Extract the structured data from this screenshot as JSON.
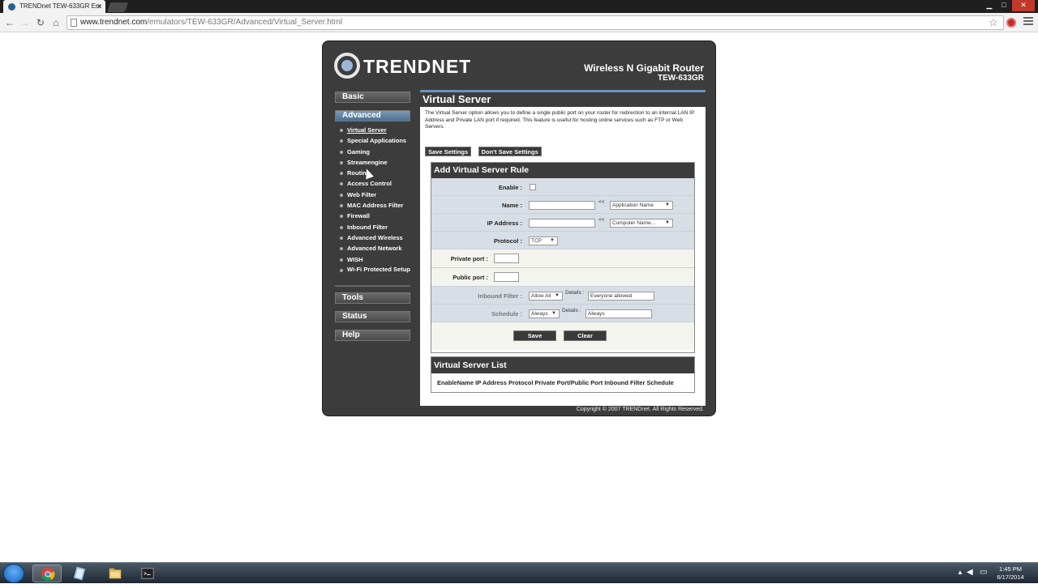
{
  "browser": {
    "tab_title": "TRENDnet TEW-633GR Em",
    "url_host": "www.trendnet.com",
    "url_path": "/emulators/TEW-633GR/Advanced/Virtual_Server.html"
  },
  "router": {
    "brand": "TRENDNET",
    "product_name": "Wireless N Gigabit Router",
    "product_model": "TEW-633GR",
    "copyright": "Copyright © 2007 TRENDnet. All Rights Reserved."
  },
  "nav": {
    "basic": "Basic",
    "advanced": "Advanced",
    "tools": "Tools",
    "status": "Status",
    "help": "Help",
    "sub_items": [
      "Virtual Server",
      "Special Applications",
      "Gaming",
      "Streamengine",
      "Routing",
      "Access Control",
      "Web Filter",
      "MAC Address Filter",
      "Firewall",
      "Inbound Filter",
      "Advanced Wireless",
      "Advanced Network",
      "WISH",
      "Wi-Fi Protected Setup"
    ]
  },
  "page": {
    "title": "Virtual Server",
    "description": "The Virtual Server option allows you to define a single public port on your router for redirection to an internal LAN IP Address and Private LAN port if required. This feature is useful for hosting online services such as FTP or Web Servers.",
    "save_settings": "Save Settings",
    "dont_save": "Don't Save Settings"
  },
  "rule_form": {
    "heading": "Add Virtual Server Rule",
    "enable_label": "Enable :",
    "name_label": "Name :",
    "ip_label": "IP Address :",
    "protocol_label": "Protocol :",
    "private_port_label": "Private port :",
    "public_port_label": "Public port :",
    "inbound_label": "Inbound Filter :",
    "schedule_label": "Schedule :",
    "copy_arrow": "<<",
    "app_name_select": "Application Name",
    "computer_name_select": "Computer Name...",
    "protocol_value": "TCP",
    "inbound_value": "Allow All",
    "schedule_value": "Always",
    "details_label": "Details :",
    "inbound_details": "Everyone allowed",
    "schedule_details": "Always",
    "save": "Save",
    "clear": "Clear"
  },
  "server_list": {
    "heading": "Virtual Server List",
    "columns": [
      "Enable",
      "Name",
      "IP Address",
      "Protocol",
      "Private Port/Public Port",
      "Inbound Filter",
      "Schedule"
    ]
  },
  "taskbar": {
    "time": "1:45 PM",
    "date": "6/17/2014"
  }
}
